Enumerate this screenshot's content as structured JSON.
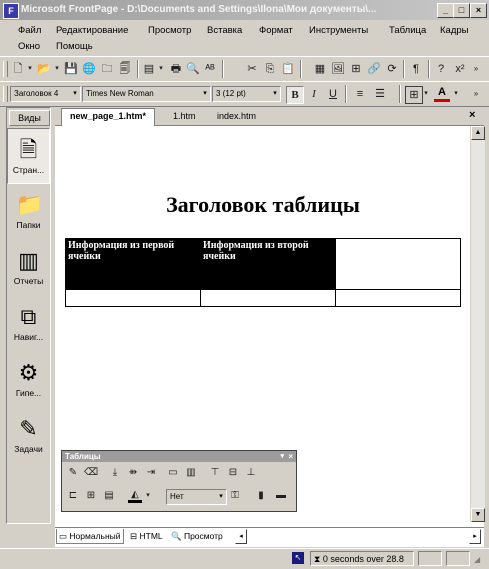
{
  "window": {
    "title": "Microsoft FrontPage - D:\\Documents and Settings\\Ilona\\Мои документы\\..."
  },
  "menu": [
    "Файл",
    "Редактирование",
    "Просмотр",
    "Вставка",
    "Формат",
    "Инструменты",
    "Таблица",
    "Кадры",
    "Окно",
    "Помощь"
  ],
  "format": {
    "style": "Заголовок 4",
    "font": "Times New Roman",
    "size": "3 (12 pt)"
  },
  "views": {
    "header": "Виды",
    "items": [
      "Стран...",
      "Папки",
      "Отчеты",
      "Навиг...",
      "Гипе...",
      "Задачи"
    ]
  },
  "tabs": [
    "new_page_1.htm*",
    "1.htm",
    "index.htm"
  ],
  "page": {
    "heading": "Заголовок таблицы",
    "cells": [
      "Информация из первой ячейки",
      "Информация из второй ячейки"
    ]
  },
  "tables_toolbar": {
    "title": "Таблицы",
    "fill_combo": "Нет"
  },
  "view_modes": [
    "Нормальный",
    "HTML",
    "Просмотр"
  ],
  "status": {
    "time": "0 seconds over 28.8"
  },
  "colors": {
    "titlebar": "#9c9c9c",
    "face": "#d4d0c8",
    "font_color": "#d00000"
  }
}
